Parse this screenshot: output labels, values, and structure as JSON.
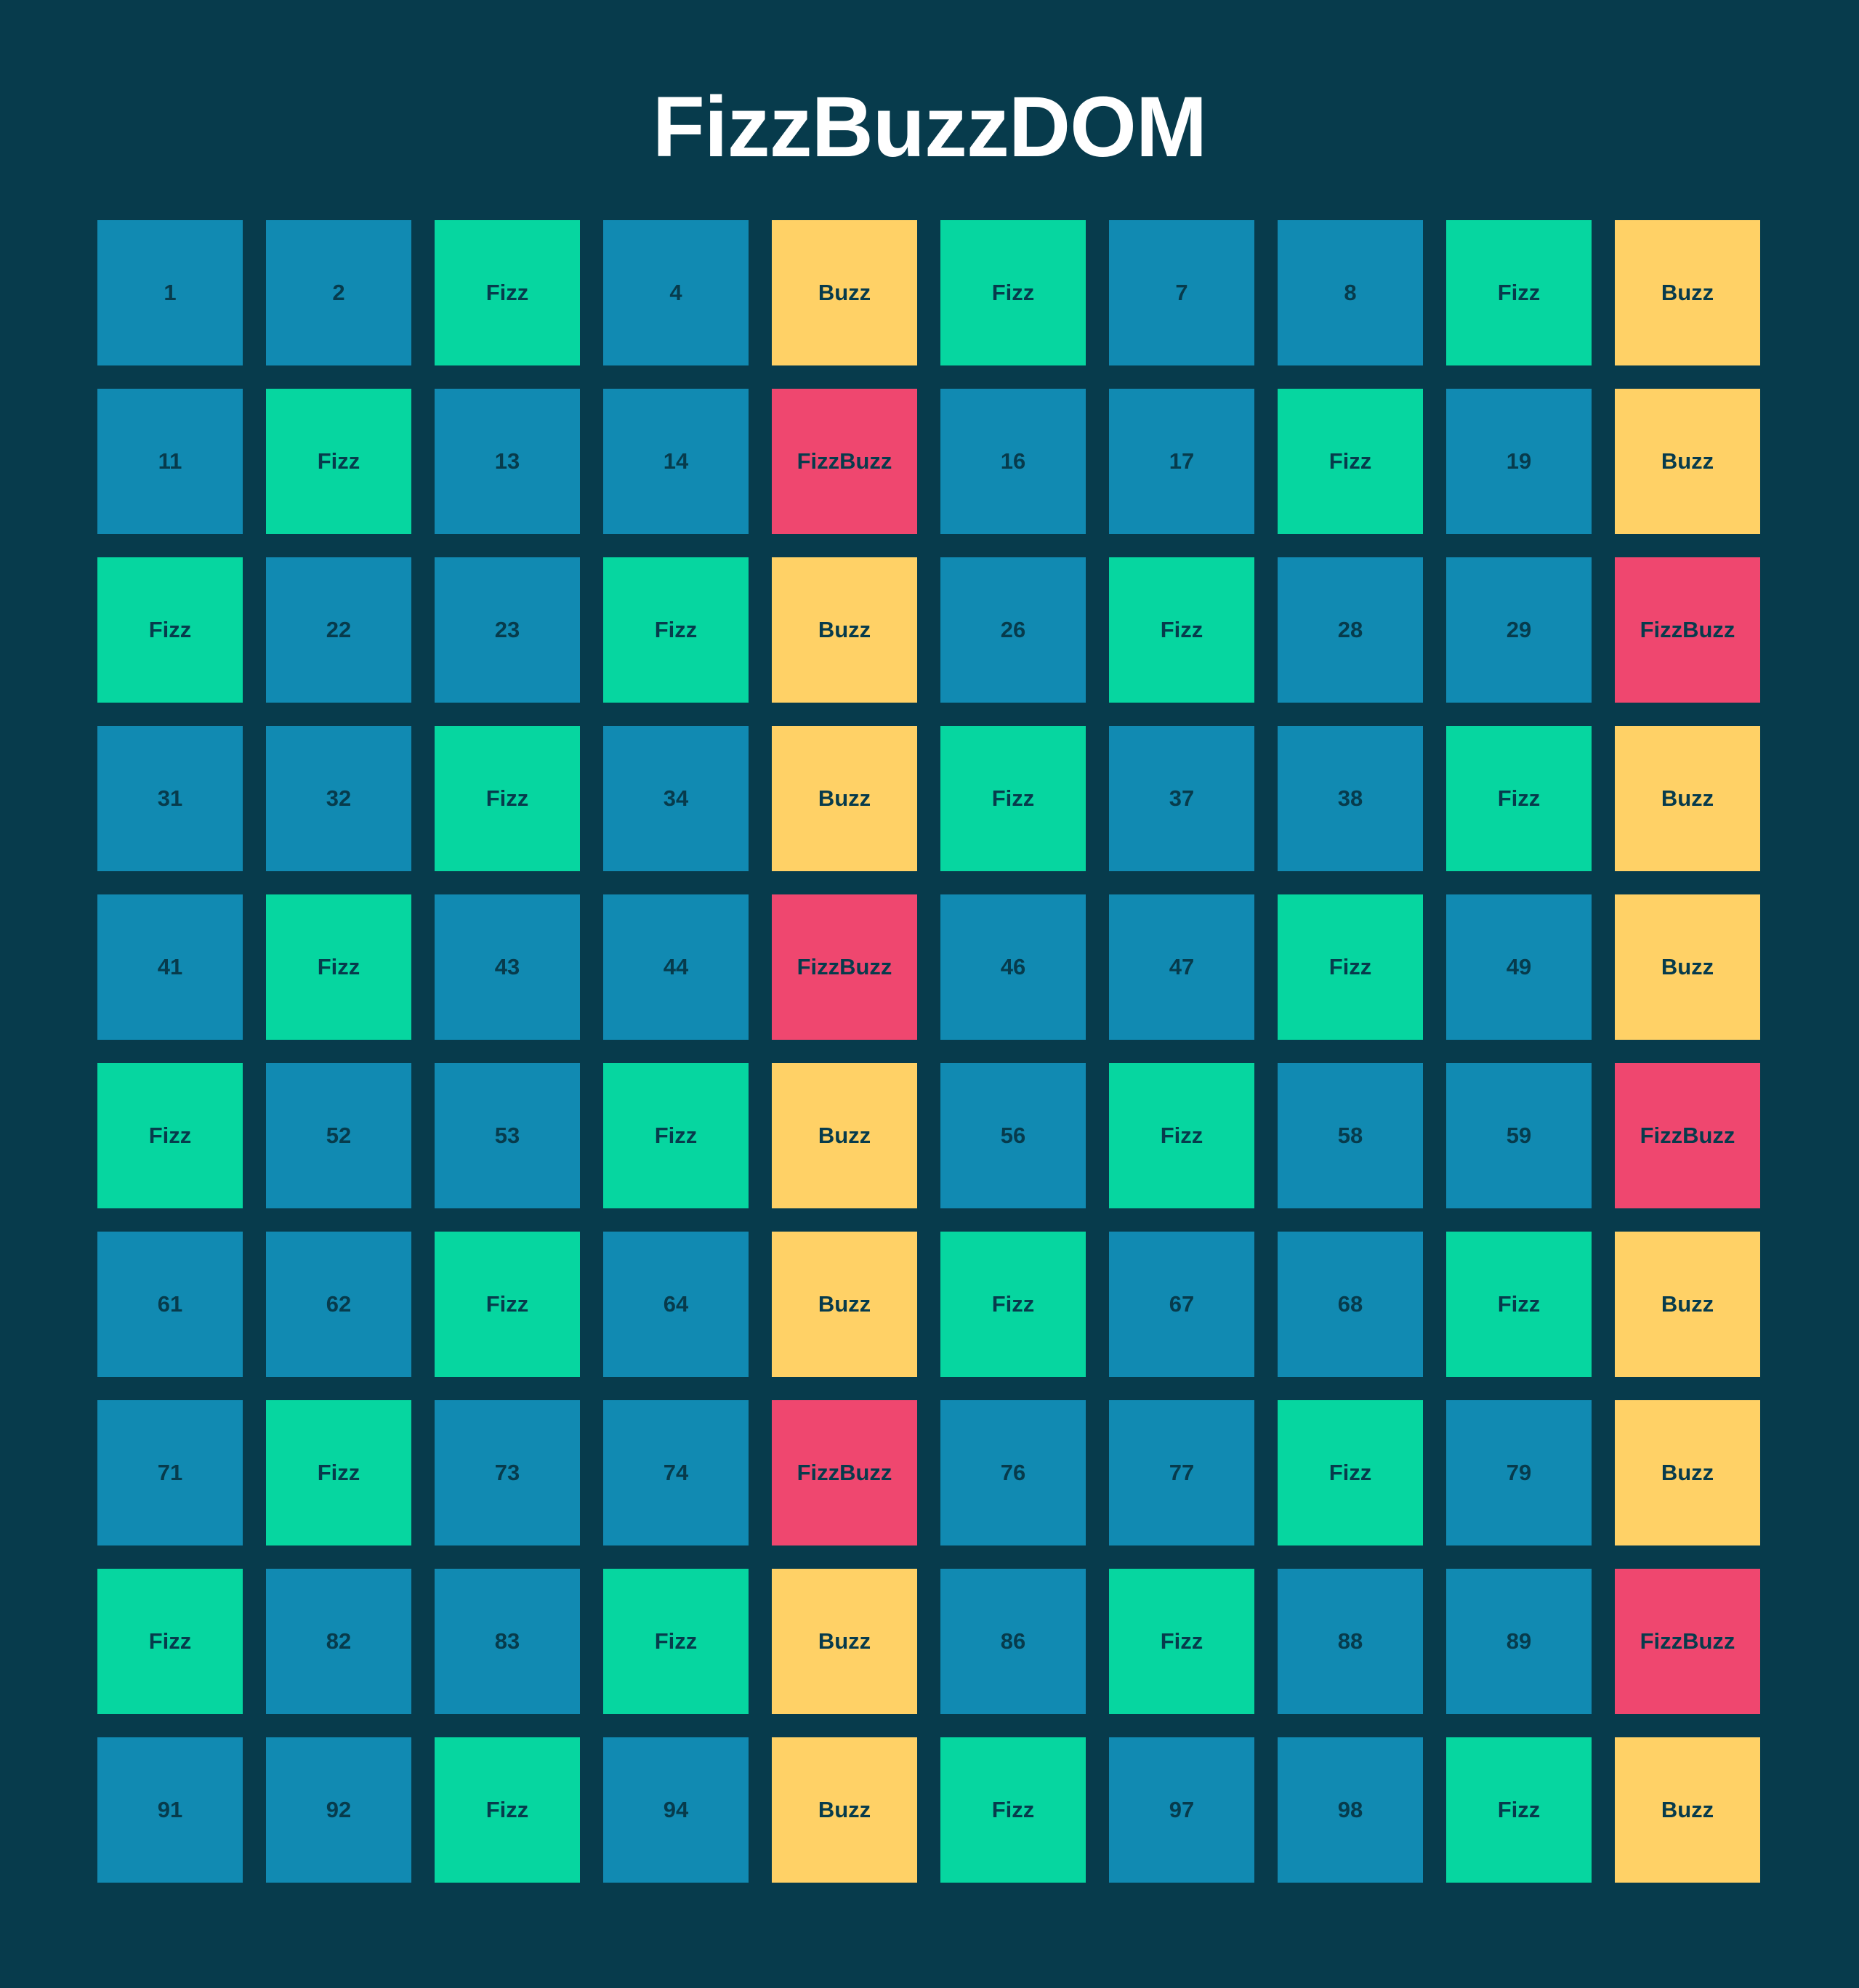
{
  "title": "FizzBuzzDOM",
  "colors": {
    "background": "#073b4c",
    "number": "#118ab2",
    "fizz": "#06d6a0",
    "buzz": "#ffd166",
    "fizzbuzz": "#ef476f",
    "text": "#073b4c"
  },
  "cells": [
    "1",
    "2",
    "Fizz",
    "4",
    "Buzz",
    "Fizz",
    "7",
    "8",
    "Fizz",
    "Buzz",
    "11",
    "Fizz",
    "13",
    "14",
    "FizzBuzz",
    "16",
    "17",
    "Fizz",
    "19",
    "Buzz",
    "Fizz",
    "22",
    "23",
    "Fizz",
    "Buzz",
    "26",
    "Fizz",
    "28",
    "29",
    "FizzBuzz",
    "31",
    "32",
    "Fizz",
    "34",
    "Buzz",
    "Fizz",
    "37",
    "38",
    "Fizz",
    "Buzz",
    "41",
    "Fizz",
    "43",
    "44",
    "FizzBuzz",
    "46",
    "47",
    "Fizz",
    "49",
    "Buzz",
    "Fizz",
    "52",
    "53",
    "Fizz",
    "Buzz",
    "56",
    "Fizz",
    "58",
    "59",
    "FizzBuzz",
    "61",
    "62",
    "Fizz",
    "64",
    "Buzz",
    "Fizz",
    "67",
    "68",
    "Fizz",
    "Buzz",
    "71",
    "Fizz",
    "73",
    "74",
    "FizzBuzz",
    "76",
    "77",
    "Fizz",
    "79",
    "Buzz",
    "Fizz",
    "82",
    "83",
    "Fizz",
    "Buzz",
    "86",
    "Fizz",
    "88",
    "89",
    "FizzBuzz",
    "91",
    "92",
    "Fizz",
    "94",
    "Buzz",
    "Fizz",
    "97",
    "98",
    "Fizz",
    "Buzz"
  ]
}
